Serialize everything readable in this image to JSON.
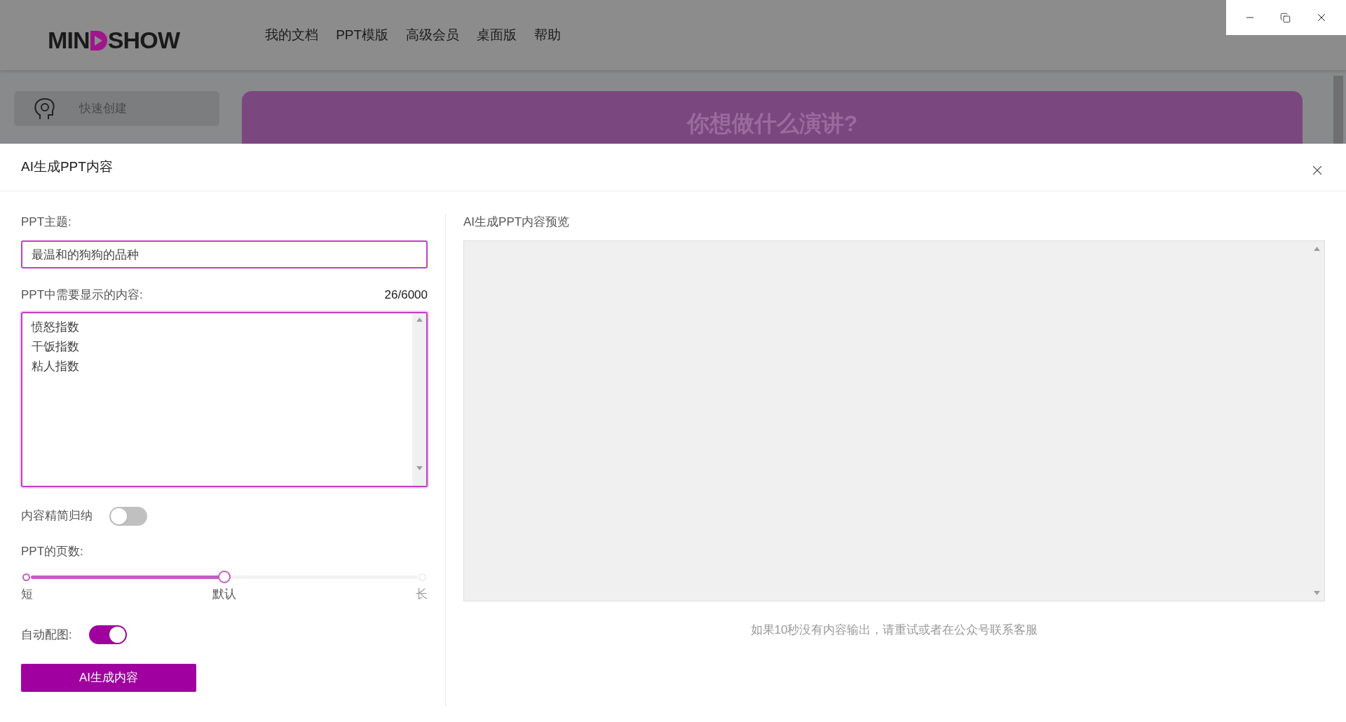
{
  "header": {
    "logo": [
      "MIN",
      "SHOW"
    ],
    "nav": [
      "我的文档",
      "PPT模版",
      "高级会员",
      "桌面版",
      "帮助"
    ]
  },
  "sidebar": {
    "items": [
      {
        "label": "快速创建",
        "selected": true
      }
    ]
  },
  "banner": {
    "title": "你想做什么演讲?"
  },
  "dialog": {
    "title": "AI生成PPT内容",
    "topic": {
      "label": "PPT主题:",
      "value": "最温和的狗狗的品种"
    },
    "content": {
      "label": "PPT中需要显示的内容:",
      "count": "26/6000",
      "lines": [
        "愤怒指数",
        "干饭指数",
        "粘人指数"
      ]
    },
    "summarize": {
      "label": "内容精简归纳",
      "on": false
    },
    "pages": {
      "label": "PPT的页数:",
      "level": 0.5,
      "marks": [
        "短",
        "默认",
        "长"
      ]
    },
    "auto_images": {
      "label": "自动配图:",
      "on": true
    },
    "generate_button": "AI生成内容",
    "preview": {
      "label": "AI生成PPT内容预览",
      "note": "如果10秒没有内容输出，请重试或者在公众号联系客服"
    }
  }
}
